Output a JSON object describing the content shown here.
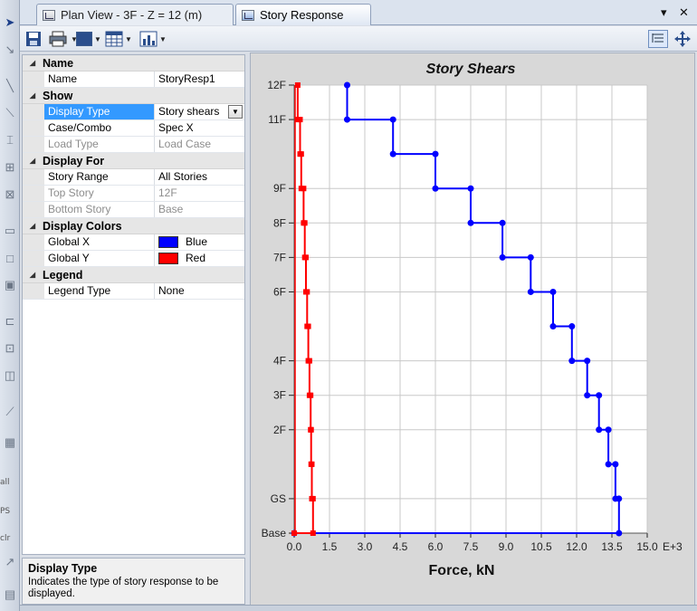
{
  "tabs": [
    {
      "label": "Plan View - 3F - Z = 12 (m)",
      "active": false
    },
    {
      "label": "Story Response",
      "active": true
    }
  ],
  "window_controls": {
    "menu": "▾",
    "close": "✕"
  },
  "strip_labels": [
    "all",
    "PS",
    "clr"
  ],
  "properties": [
    {
      "kind": "cat",
      "label": "Name"
    },
    {
      "kind": "prop",
      "name": "Name",
      "value": "StoryResp1"
    },
    {
      "kind": "cat",
      "label": "Show"
    },
    {
      "kind": "prop",
      "name": "Display Type",
      "value": "Story shears",
      "selected": true,
      "dropdown": true
    },
    {
      "kind": "prop",
      "name": "Case/Combo",
      "value": "Spec X"
    },
    {
      "kind": "prop",
      "name": "Load Type",
      "value": "Load Case",
      "disabled": true
    },
    {
      "kind": "cat",
      "label": "Display For"
    },
    {
      "kind": "prop",
      "name": "Story Range",
      "value": "All Stories"
    },
    {
      "kind": "prop",
      "name": "Top Story",
      "value": "12F",
      "disabled": true
    },
    {
      "kind": "prop",
      "name": "Bottom Story",
      "value": "Base",
      "disabled": true
    },
    {
      "kind": "cat",
      "label": "Display Colors"
    },
    {
      "kind": "prop",
      "name": "Global X",
      "value": "Blue",
      "swatch": "#0000ff"
    },
    {
      "kind": "prop",
      "name": "Global Y",
      "value": "Red",
      "swatch": "#ff0000"
    },
    {
      "kind": "cat",
      "label": "Legend"
    },
    {
      "kind": "prop",
      "name": "Legend Type",
      "value": "None"
    }
  ],
  "description": {
    "title": "Display Type",
    "text_line1": "Indicates the type of story response to be",
    "text_line2": "displayed."
  },
  "colors": {
    "global_x": "#0000ff",
    "global_y": "#ff0000",
    "plot_bg": "#ffffff",
    "panel_bg": "#d8d8d8"
  },
  "chart_data": {
    "type": "line",
    "title": "Story Shears",
    "xlabel": "Force, kN",
    "x_multiplier": "E+3",
    "xlim": [
      0,
      15
    ],
    "x_ticks": [
      "0.0",
      "1.5",
      "3.0",
      "4.5",
      "6.0",
      "7.5",
      "9.0",
      "10.5",
      "12.0",
      "13.5",
      "15.0"
    ],
    "stories": [
      {
        "label": "Base",
        "elevation": 0
      },
      {
        "label": "GS",
        "elevation": 1
      },
      {
        "label": "2F",
        "elevation": 3
      },
      {
        "label": "3F",
        "elevation": 4
      },
      {
        "label": "4F",
        "elevation": 5
      },
      {
        "label": "6F",
        "elevation": 7
      },
      {
        "label": "7F",
        "elevation": 8
      },
      {
        "label": "8F",
        "elevation": 9
      },
      {
        "label": "9F",
        "elevation": 10
      },
      {
        "label": "11F",
        "elevation": 12
      },
      {
        "label": "12F",
        "elevation": 13
      }
    ],
    "ylim": [
      0,
      13
    ],
    "grid": true,
    "series": [
      {
        "key": "global_x",
        "points": [
          [
            2.25,
            13
          ],
          [
            2.25,
            12
          ],
          [
            4.2,
            12
          ],
          [
            4.2,
            11
          ],
          [
            6.0,
            11
          ],
          [
            6.0,
            10
          ],
          [
            7.5,
            10
          ],
          [
            7.5,
            9
          ],
          [
            8.85,
            9
          ],
          [
            8.85,
            8
          ],
          [
            10.05,
            8
          ],
          [
            10.05,
            7
          ],
          [
            11.0,
            7
          ],
          [
            11.0,
            6
          ],
          [
            11.8,
            6
          ],
          [
            11.8,
            5
          ],
          [
            12.45,
            5
          ],
          [
            12.45,
            4
          ],
          [
            12.95,
            4
          ],
          [
            12.95,
            3
          ],
          [
            13.35,
            3
          ],
          [
            13.35,
            2
          ],
          [
            13.65,
            2
          ],
          [
            13.65,
            1
          ],
          [
            13.8,
            1
          ],
          [
            13.8,
            0
          ],
          [
            0,
            0
          ]
        ]
      },
      {
        "key": "global_y",
        "points": [
          [
            0.15,
            13
          ],
          [
            0.15,
            12
          ],
          [
            0.25,
            12
          ],
          [
            0.25,
            11
          ],
          [
            0.3,
            11
          ],
          [
            0.3,
            10
          ],
          [
            0.4,
            10
          ],
          [
            0.4,
            9
          ],
          [
            0.45,
            9
          ],
          [
            0.45,
            8
          ],
          [
            0.5,
            8
          ],
          [
            0.5,
            7
          ],
          [
            0.55,
            7
          ],
          [
            0.55,
            6
          ],
          [
            0.6,
            6
          ],
          [
            0.6,
            5
          ],
          [
            0.65,
            5
          ],
          [
            0.65,
            4
          ],
          [
            0.7,
            4
          ],
          [
            0.7,
            3
          ],
          [
            0.72,
            3
          ],
          [
            0.72,
            2
          ],
          [
            0.75,
            2
          ],
          [
            0.75,
            1
          ],
          [
            0.8,
            1
          ],
          [
            0.8,
            0
          ],
          [
            0,
            0
          ]
        ]
      }
    ]
  }
}
